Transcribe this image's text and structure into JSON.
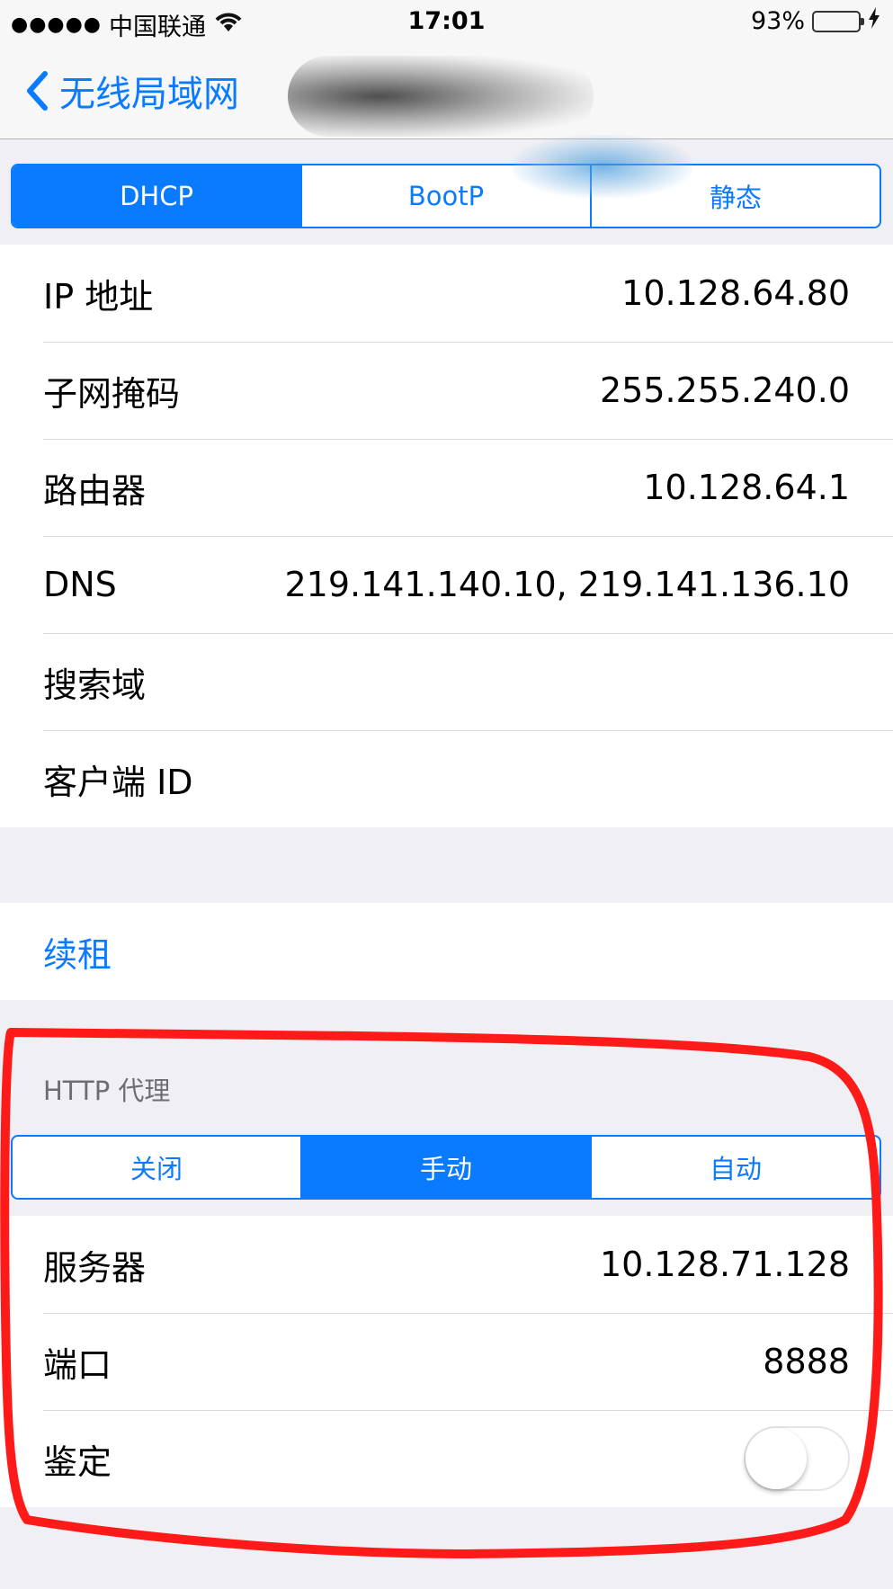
{
  "status_bar": {
    "signal": "●●●●●",
    "carrier": "中国联通",
    "time": "17:01",
    "battery_percent": "93%",
    "battery_level": 0.93
  },
  "nav": {
    "back_label": "无线局域网"
  },
  "ip_mode": {
    "options": [
      "DHCP",
      "BootP",
      "静态"
    ],
    "selected": "DHCP"
  },
  "ip_info": {
    "rows": [
      {
        "label": "IP 地址",
        "value": "10.128.64.80"
      },
      {
        "label": "子网掩码",
        "value": "255.255.240.0"
      },
      {
        "label": "路由器",
        "value": "10.128.64.1"
      },
      {
        "label": "DNS",
        "value": "219.141.140.10, 219.141.136.10"
      },
      {
        "label": "搜索域",
        "value": ""
      },
      {
        "label": "客户端 ID",
        "value": ""
      }
    ]
  },
  "renew": {
    "label": "续租"
  },
  "http_proxy": {
    "header": "HTTP 代理",
    "options": [
      "关闭",
      "手动",
      "自动"
    ],
    "selected": "手动",
    "server_label": "服务器",
    "server_value": "10.128.71.128",
    "port_label": "端口",
    "port_value": "8888",
    "auth_label": "鉴定",
    "auth_enabled": false
  },
  "colors": {
    "accent": "#0a7bff",
    "background": "#efeff4",
    "annotation": "#ff1a1a"
  }
}
